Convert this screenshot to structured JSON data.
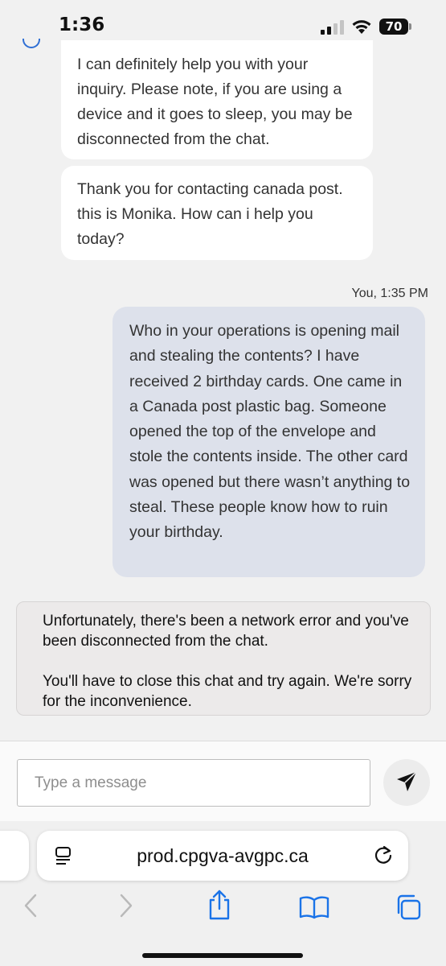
{
  "status_bar": {
    "time": "1:36",
    "battery": "70"
  },
  "messages": {
    "agent_1": "I can definitely help you with your inquiry. Please note, if you are using a device and it goes to sleep, you may be disconnected from the chat.",
    "agent_2": "Thank you for contacting canada post. this is Monika. How can i help you today?",
    "user_meta": "You, 1:35 PM",
    "user_1": "Who in your operations is opening mail and stealing the contents? I have received 2 birthday cards. One came in a Canada post plastic bag. Someone opened the top of the envelope and stole the contents inside. The other card was opened but there wasn’t anything to steal. These people know how to ruin your birthday."
  },
  "system_notice": {
    "line_1": "Unfortunately, there's been a network error and you've been disconnected from the chat.",
    "line_2": "You'll have to close this chat and try again. We're sorry for the inconvenience."
  },
  "composer": {
    "placeholder": "Type a message",
    "value": ""
  },
  "browser": {
    "url": "prod.cpgva-avgpc.ca"
  },
  "icons": {
    "signal": "signal-icon",
    "wifi": "wifi-icon",
    "send": "send-icon",
    "reader": "reader-mode-icon",
    "reload": "reload-icon",
    "back": "back-icon",
    "forward": "forward-icon",
    "share": "share-icon",
    "bookmarks": "bookmarks-icon",
    "tabs": "tabs-icon"
  },
  "colors": {
    "accent_blue": "#1a73e8",
    "user_bubble": "#dde1eb",
    "agent_bubble": "#ffffff",
    "background": "#f1f1f1"
  }
}
